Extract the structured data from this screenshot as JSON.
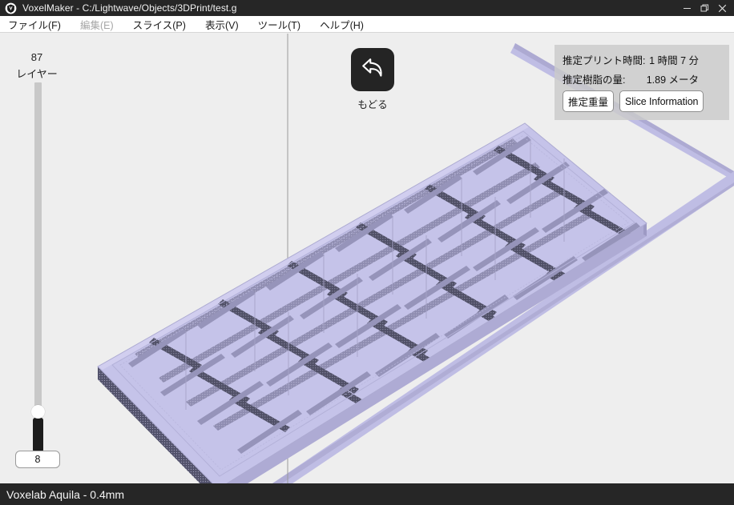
{
  "window": {
    "title": "VoxelMaker - C:/Lightwave/Objects/3DPrint/test.g",
    "app_icon": "voxelmaker-logo-icon",
    "minimize_label": "—",
    "maximize_label": "❐",
    "close_label": "✕"
  },
  "menubar": {
    "items": [
      {
        "label": "ファイル(F)",
        "disabled": false
      },
      {
        "label": "編集(E)",
        "disabled": true
      },
      {
        "label": "スライス(P)",
        "disabled": false
      },
      {
        "label": "表示(V)",
        "disabled": false
      },
      {
        "label": "ツール(T)",
        "disabled": false
      },
      {
        "label": "ヘルプ(H)",
        "disabled": false
      }
    ]
  },
  "layer_slider": {
    "count": "87",
    "label": "レイヤー",
    "current_value": "8",
    "min": 1,
    "max": 87
  },
  "undo": {
    "label": "もどる",
    "icon": "undo-arrow-icon"
  },
  "info_panel": {
    "print_time_label": "推定プリント時間:",
    "print_time_value": "1 時間 7 分",
    "resin_label": "推定樹脂の量:",
    "resin_value": "1.89 メータ",
    "weight_button": "推定重量",
    "slice_info_button": "Slice Information"
  },
  "statusbar": {
    "text": "Voxelab Aquila - 0.4mm"
  },
  "colors": {
    "titlebar_bg": "#262626",
    "viewport_bg": "#eeeeee",
    "model_top": "#c3c1e8",
    "model_side": "#a9a7cf",
    "model_infill": "#4a4a60",
    "bed_line": "#bdbbe2",
    "accent_dark": "#1c1c1c"
  },
  "viewport": {
    "model_name": "sliced-3d-model-preview",
    "bed_outline_name": "print-bed-outline",
    "vertical_guide_name": "build-volume-edge"
  }
}
